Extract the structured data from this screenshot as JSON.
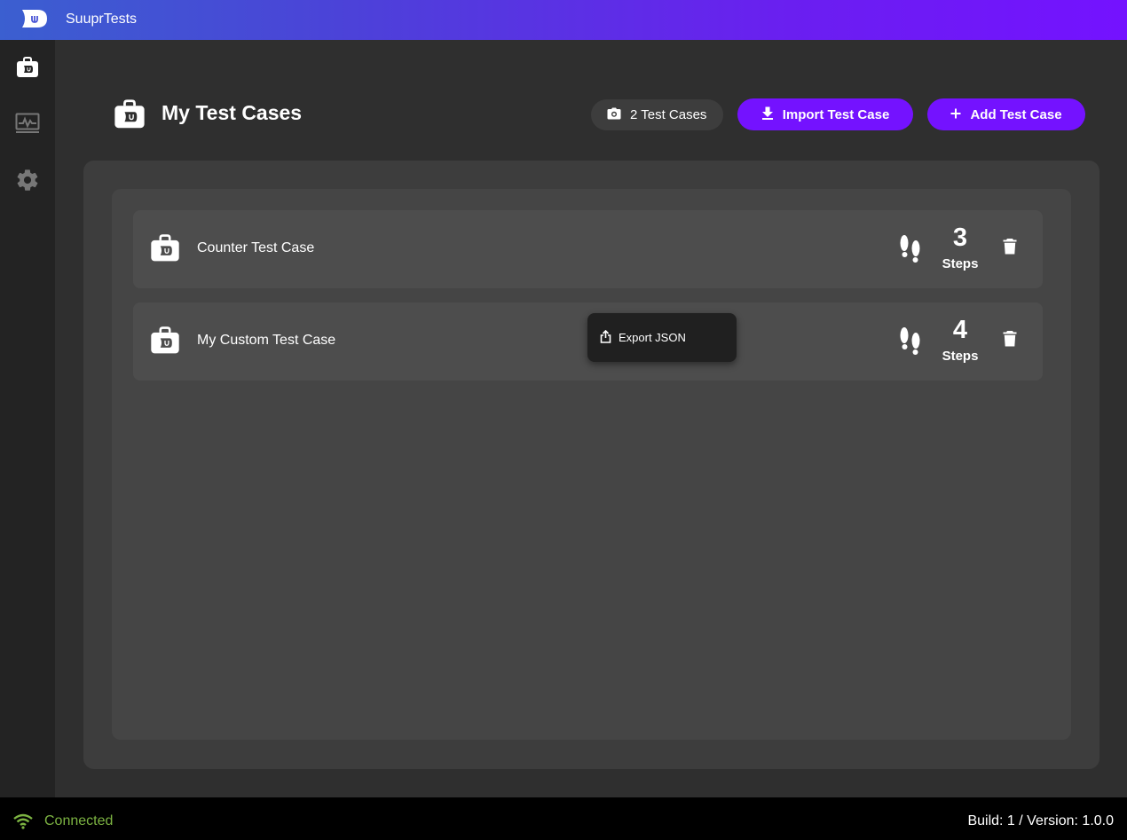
{
  "app": {
    "title": "SuuprTests"
  },
  "page": {
    "title": "My Test Cases"
  },
  "toolbar": {
    "count_label": "2 Test Cases",
    "import_label": "Import Test Case",
    "add_label": "Add Test Case"
  },
  "test_cases": [
    {
      "name": "Counter Test Case",
      "steps": "3",
      "steps_label": "Steps"
    },
    {
      "name": "My Custom Test Case",
      "steps": "4",
      "steps_label": "Steps"
    }
  ],
  "context_menu": {
    "export_label": "Export JSON"
  },
  "status": {
    "connection": "Connected",
    "version": "Build: 1 / Version: 1.0.0"
  },
  "colors": {
    "accent": "#7412ff",
    "connected": "#7cb342",
    "gradient_start": "#3b5fd0",
    "gradient_end": "#7412ff"
  },
  "icons": {
    "sidebar": [
      "suitcase-icon",
      "monitor-activity-icon",
      "gear-icon"
    ],
    "row": [
      "suitcase-icon",
      "footsteps-icon",
      "trash-icon"
    ],
    "toolbar": [
      "camera-icon",
      "download-icon",
      "plus-icon"
    ],
    "menu": [
      "share-icon"
    ],
    "status": [
      "wifi-icon"
    ]
  }
}
